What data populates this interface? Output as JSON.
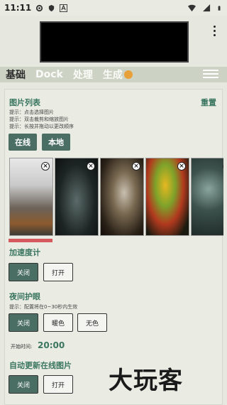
{
  "status_bar": {
    "time": "11:11"
  },
  "tabs": [
    {
      "label": "基础"
    },
    {
      "label": "Dock"
    },
    {
      "label": "处理"
    },
    {
      "label": "生成"
    }
  ],
  "gallery": {
    "title": "图片列表",
    "reset": "重置",
    "hints": [
      "提示：点击选择图片",
      "提示：双击裁剪和缩放图片",
      "提示：长按并拖动以更改顺序"
    ],
    "online_button": "在线",
    "local_button": "本地",
    "thumbnails": [
      {
        "subject": "foggy forest"
      },
      {
        "subject": "dark car in fog"
      },
      {
        "subject": "sheep"
      },
      {
        "subject": "parrot"
      },
      {
        "subject": "pine cones"
      }
    ]
  },
  "accelerometer": {
    "title": "加速度计",
    "off": "关闭",
    "on": "打开"
  },
  "night_mode": {
    "title": "夜间护眼",
    "hint": "提示：配置将在0~30秒内生效",
    "options": [
      "关闭",
      "暖色",
      "无色"
    ],
    "start_label": "开始时间:",
    "start_time": "20:00"
  },
  "auto_update": {
    "title": "自动更新在线图片",
    "off": "关闭",
    "on": "打开"
  },
  "watermark": "大玩客",
  "colors": {
    "accent": "#3a7560",
    "button": "#4a6e63",
    "selection": "#d45a5f",
    "tabbar": "#ccd3c4"
  }
}
